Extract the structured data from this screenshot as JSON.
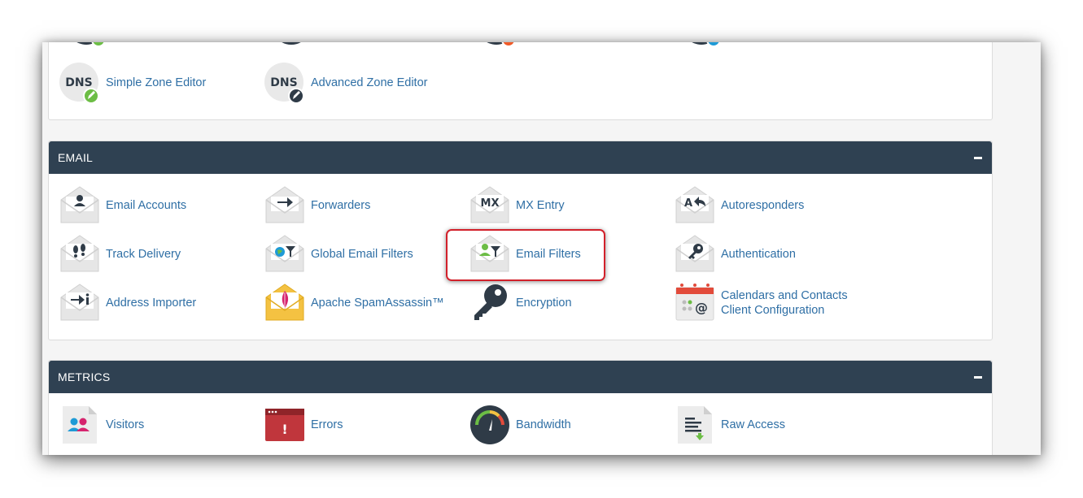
{
  "domain_section": {
    "items": [
      {
        "label": "Simple Zone Editor",
        "icon_text": "DNS",
        "icon": "dns-edit-icon"
      },
      {
        "label": "Advanced Zone Editor",
        "icon_text": "DNS",
        "icon": "dns-advanced-icon"
      }
    ]
  },
  "email_section": {
    "title": "EMAIL",
    "items": [
      {
        "label": "Email Accounts",
        "icon": "email-accounts-icon"
      },
      {
        "label": "Forwarders",
        "icon": "forwarders-icon"
      },
      {
        "label": "MX Entry",
        "icon": "mx-entry-icon",
        "icon_text": "MX"
      },
      {
        "label": "Autoresponders",
        "icon": "autoresponders-icon",
        "icon_text": "A"
      },
      {
        "label": "Track Delivery",
        "icon": "track-delivery-icon"
      },
      {
        "label": "Global Email Filters",
        "icon": "global-email-filters-icon"
      },
      {
        "label": "Email Filters",
        "icon": "email-filters-icon"
      },
      {
        "label": "Authentication",
        "icon": "authentication-icon"
      },
      {
        "label": "Address Importer",
        "icon": "address-importer-icon"
      },
      {
        "label": "Apache SpamAssassin™",
        "icon": "spamassassin-icon"
      },
      {
        "label": "Encryption",
        "icon": "encryption-icon"
      },
      {
        "label": "Calendars and Contacts",
        "label_line2": "Client Configuration",
        "icon": "calendar-contacts-icon",
        "icon_text": "@"
      }
    ]
  },
  "metrics_section": {
    "title": "METRICS",
    "items": [
      {
        "label": "Visitors",
        "icon": "visitors-icon"
      },
      {
        "label": "Errors",
        "icon": "errors-icon",
        "icon_text": "!"
      },
      {
        "label": "Bandwidth",
        "icon": "bandwidth-icon"
      },
      {
        "label": "Raw Access",
        "icon": "raw-access-icon"
      }
    ]
  },
  "colors": {
    "header_bg": "#2f4152",
    "link": "#2f6fa5",
    "highlight": "#d2202a",
    "icon_dark": "#2f3b47",
    "envelope": "#eeeeee"
  }
}
